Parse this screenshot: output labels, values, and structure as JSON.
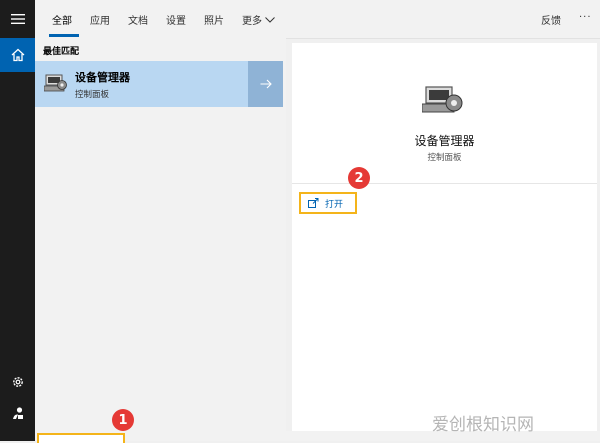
{
  "tabs": [
    {
      "label": "全部",
      "active": true
    },
    {
      "label": "应用"
    },
    {
      "label": "文档"
    },
    {
      "label": "设置"
    },
    {
      "label": "照片"
    },
    {
      "label": "更多"
    }
  ],
  "topbar": {
    "feedback_label": "反馈",
    "more_options": "···"
  },
  "best_match": {
    "section_title": "最佳匹配",
    "title": "设备管理器",
    "subtitle": "控制面板"
  },
  "detail": {
    "title": "设备管理器",
    "subtitle": "控制面板",
    "open_label": "打开"
  },
  "annotations": {
    "badge_1": "1",
    "badge_2": "2"
  },
  "watermark": "爱创根知识网",
  "colors": {
    "accent": "#0063b1",
    "highlight_box": "#f4b41a",
    "badge": "#e53935",
    "selected_row": "#b9d7f2"
  },
  "icons": {
    "rail": [
      "hamburger-menu-icon",
      "home-icon",
      "settings-gear-icon",
      "user-account-icon"
    ],
    "result_icon": "device-manager-icon",
    "arrow": "arrow-right-icon",
    "open_icon": "open-window-icon"
  }
}
